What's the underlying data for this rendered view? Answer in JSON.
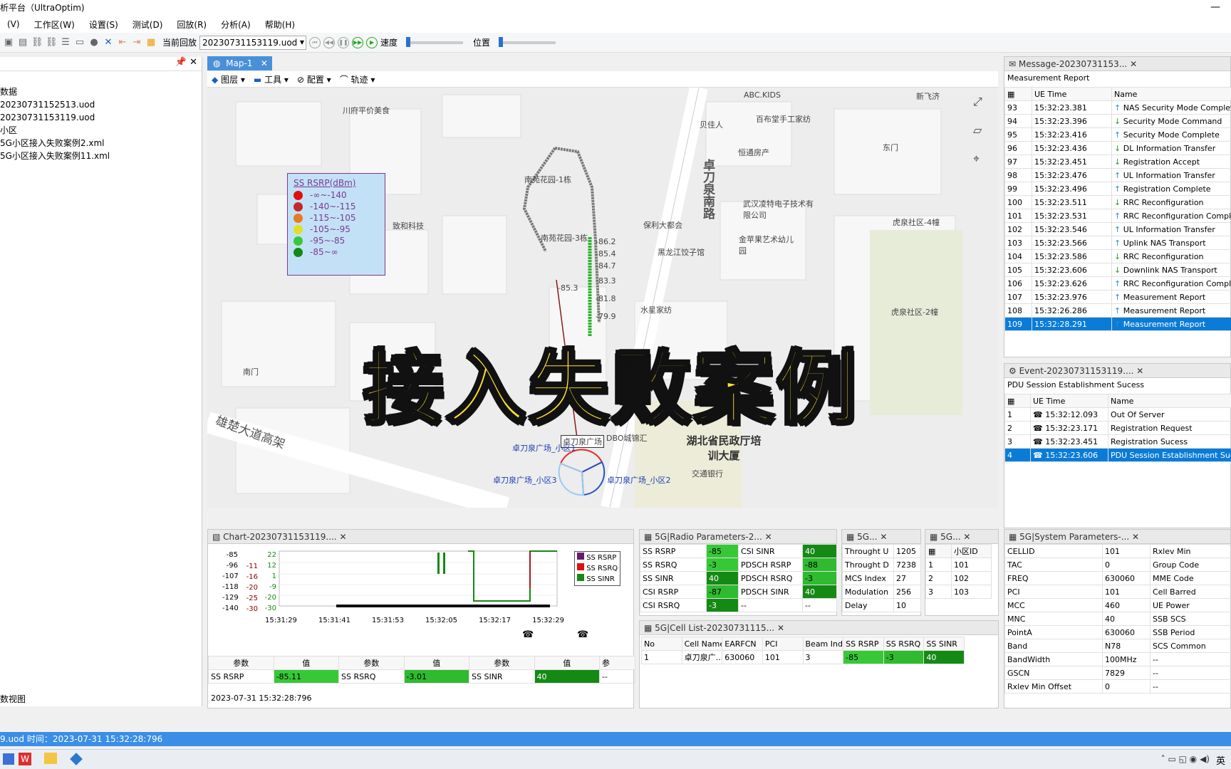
{
  "app_title": "析平台（UltraOptim)",
  "menu": [
    "(V)",
    "工作区(W)",
    "设置(S)",
    "测试(D)",
    "回放(R)",
    "分析(A)",
    "帮助(H)"
  ],
  "toolbar": {
    "replay_label": "当前回放",
    "file": "20230731153119.uod",
    "speed_label": "速度",
    "position_label": "位置"
  },
  "left_tree": [
    "数据",
    "20230731152513.uod",
    "20230731153119.uod",
    "小区",
    "5G小区接入失败案例2.xml",
    "5G小区接入失败案例11.xml"
  ],
  "left_footer": "数视图",
  "map": {
    "tab": "Map-1",
    "tools": [
      "图层",
      "工具",
      "配置",
      "轨迹"
    ],
    "legend": {
      "title": "SS RSRP(dBm)",
      "items": [
        {
          "label": "-∞~-140",
          "color": "#e01010"
        },
        {
          "label": "-140~-115",
          "color": "#c4282a"
        },
        {
          "label": "-115~-105",
          "color": "#e87a20"
        },
        {
          "label": "-105~-95",
          "color": "#e0e020"
        },
        {
          "label": "-95~-85",
          "color": "#38c838"
        },
        {
          "label": "-85~∞",
          "color": "#148a14"
        }
      ]
    },
    "pois": [
      "川府平价美食",
      "致和科技",
      "南苑花园-1栋",
      "南苑花园-3栋",
      "保利大都会",
      "黑龙江饺子馆",
      "水星家纺",
      "ABC.KIDS",
      "百布堂手工家纺",
      "贝佳人",
      "恒通房产",
      "武汉凌特电子技术有限公司",
      "金苹果艺术幼儿园",
      "东门",
      "南门",
      "虎泉社区-4幢",
      "虎泉社区-2幢",
      "卓刀泉南路",
      "雄楚大道高架",
      "湖北省民政厅培训大厦",
      "交通银行",
      "卓刀泉广场",
      "卓刀泉广场_小区1",
      "卓刀泉广场_小区3",
      "卓刀泉广场_小区2",
      "DBO城锦汇",
      "新飞济"
    ],
    "track_values": [
      "-86.2",
      "-85.4",
      "-84.7",
      "-83.3",
      "-81.8",
      "-79.9",
      "-85.3"
    ]
  },
  "overlay_text": "接入失败案例",
  "message": {
    "tab": "Message-20230731153...",
    "subtitle": "Measurement Report",
    "cols": [
      "UE Time",
      "Name"
    ],
    "rows": [
      [
        "93",
        "15:32:23.381",
        "NAS Security Mode Complete"
      ],
      [
        "94",
        "15:32:23.396",
        "Security Mode Command"
      ],
      [
        "95",
        "15:32:23.416",
        "Security Mode Complete"
      ],
      [
        "96",
        "15:32:23.436",
        "DL Information Transfer"
      ],
      [
        "97",
        "15:32:23.451",
        "Registration Accept"
      ],
      [
        "98",
        "15:32:23.476",
        "UL Information Transfer"
      ],
      [
        "99",
        "15:32:23.496",
        "Registration Complete"
      ],
      [
        "100",
        "15:32:23.511",
        "RRC Reconfiguration"
      ],
      [
        "101",
        "15:32:23.531",
        "RRC Reconfiguration Complete"
      ],
      [
        "102",
        "15:32:23.546",
        "UL Information Transfer"
      ],
      [
        "103",
        "15:32:23.566",
        "Uplink NAS Transport"
      ],
      [
        "104",
        "15:32:23.586",
        "RRC Reconfiguration"
      ],
      [
        "105",
        "15:32:23.606",
        "Downlink NAS Transport"
      ],
      [
        "106",
        "15:32:23.626",
        "RRC Reconfiguration Complete"
      ],
      [
        "107",
        "15:32:23.976",
        "Measurement Report"
      ],
      [
        "108",
        "15:32:26.286",
        "Measurement Report"
      ],
      [
        "109",
        "15:32:28.291",
        "Measurement Report"
      ]
    ]
  },
  "event": {
    "tab": "Event-20230731153119....",
    "subtitle": "PDU Session Establishment Sucess",
    "cols": [
      "UE Time",
      "Name"
    ],
    "rows": [
      [
        "1",
        "15:32:12.093",
        "Out Of Server"
      ],
      [
        "2",
        "15:32:23.171",
        "Registration Request"
      ],
      [
        "3",
        "15:32:23.451",
        "Registration Sucess"
      ],
      [
        "4",
        "15:32:23.606",
        "PDU Session Establishment Suce"
      ]
    ]
  },
  "chart": {
    "tab": "Chart-20230731153119....",
    "y1": [
      "-85",
      "-96",
      "-107",
      "-118",
      "-129",
      "-140"
    ],
    "y2": [
      "-11",
      "-16",
      "-20",
      "-25",
      "-30"
    ],
    "y3": [
      "22",
      "12",
      "1",
      "-9",
      "-20",
      "-30"
    ],
    "x": [
      "15:31:29",
      "15:31:41",
      "15:31:53",
      "15:32:05",
      "15:32:17",
      "15:32:29"
    ],
    "legend": [
      "SS RSRP",
      "SS RSRQ",
      "SS SINR"
    ],
    "table_head": [
      "参数",
      "值",
      "参数",
      "值",
      "参数",
      "值",
      "参"
    ],
    "table_row": [
      "SS RSRP",
      "-85.11",
      "SS RSRQ",
      "-3.01",
      "SS SINR",
      "40",
      "--"
    ],
    "time": "2023-07-31  15:32:28:796"
  },
  "radio": {
    "tab": "5G|Radio Parameters-2...",
    "rows": [
      [
        "SS RSRP",
        "-85",
        "CSI SINR",
        "40"
      ],
      [
        "SS RSRQ",
        "-3",
        "PDSCH RSRP",
        "-88"
      ],
      [
        "SS SINR",
        "40",
        "PDSCH RSRQ",
        "-3"
      ],
      [
        "CSI RSRP",
        "-87",
        "PDSCH SINR",
        "40"
      ],
      [
        "CSI RSRQ",
        "-3",
        "--",
        "--"
      ]
    ]
  },
  "throughput": {
    "tab": "5G...",
    "rows": [
      [
        "Throught U",
        "1205"
      ],
      [
        "Throught D",
        "7238"
      ],
      [
        "MCS Index",
        "27"
      ],
      [
        "Modulation",
        "256"
      ],
      [
        "Delay",
        "10"
      ]
    ]
  },
  "cellid": {
    "tab": "5G...",
    "head": "小区ID",
    "rows": [
      [
        "1",
        "101"
      ],
      [
        "2",
        "102"
      ],
      [
        "3",
        "103"
      ]
    ]
  },
  "celllist": {
    "tab": "5G|Cell List-20230731115...",
    "head": [
      "No",
      "Cell Name",
      "EARFCN",
      "PCI",
      "Beam Index",
      "SS RSRP",
      "SS RSRQ",
      "SS SINR"
    ],
    "row": [
      "1",
      "卓刀泉广...",
      "630060",
      "101",
      "3",
      "-85",
      "-3",
      "40"
    ]
  },
  "system": {
    "tab": "5G|System Parameters-...",
    "rows": [
      [
        "CELLID",
        "101",
        "Rxlev Min"
      ],
      [
        "TAC",
        "0",
        "Group Code"
      ],
      [
        "FREQ",
        "630060",
        "MME Code"
      ],
      [
        "PCI",
        "101",
        "Cell Barred"
      ],
      [
        "MCC",
        "460",
        "UE Power"
      ],
      [
        "MNC",
        "40",
        "SSB SCS"
      ],
      [
        "PointA",
        "630060",
        "SSB Period"
      ],
      [
        "Band",
        "N78",
        "SCS Common"
      ],
      [
        "BandWidth",
        "100MHz",
        "--"
      ],
      [
        "GSCN",
        "7829",
        "--"
      ],
      [
        "Rxlev Min Offset",
        "0",
        "--"
      ]
    ]
  },
  "status": "9.uod  时间：2023-07-31 15:32:28:796",
  "tray": "英"
}
